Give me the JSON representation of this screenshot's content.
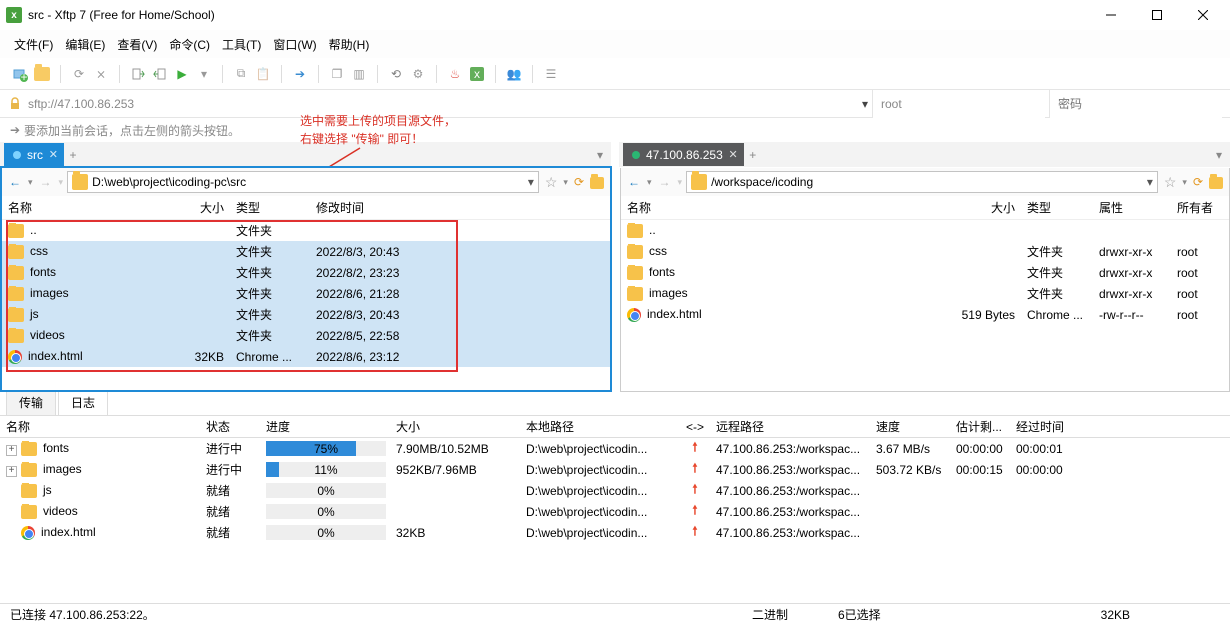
{
  "window": {
    "title": "src - Xftp 7 (Free for Home/School)"
  },
  "menu": {
    "file": "文件(F)",
    "edit": "编辑(E)",
    "view": "查看(V)",
    "cmd": "命令(C)",
    "tool": "工具(T)",
    "win": "窗口(W)",
    "help": "帮助(H)"
  },
  "conn": {
    "host": "sftp://47.100.86.253",
    "user": "root",
    "pass_placeholder": "密码"
  },
  "hint": "要添加当前会话，点击左侧的箭头按钮。",
  "callout_l1": "选中需要上传的项目源文件，",
  "callout_l2": "右键选择 \"传输\" 即可！",
  "left": {
    "tab": "src",
    "path": "D:\\web\\project\\icoding-pc\\src",
    "cols": {
      "name": "名称",
      "size": "大小",
      "type": "类型",
      "time": "修改时间"
    },
    "rows": [
      {
        "icon": "folder",
        "name": "..",
        "size": "",
        "type": "文件夹",
        "time": "",
        "sel": false
      },
      {
        "icon": "folder",
        "name": "css",
        "size": "",
        "type": "文件夹",
        "time": "2022/8/3, 20:43",
        "sel": true
      },
      {
        "icon": "folder",
        "name": "fonts",
        "size": "",
        "type": "文件夹",
        "time": "2022/8/2, 23:23",
        "sel": true
      },
      {
        "icon": "folder",
        "name": "images",
        "size": "",
        "type": "文件夹",
        "time": "2022/8/6, 21:28",
        "sel": true
      },
      {
        "icon": "folder",
        "name": "js",
        "size": "",
        "type": "文件夹",
        "time": "2022/8/3, 20:43",
        "sel": true
      },
      {
        "icon": "folder",
        "name": "videos",
        "size": "",
        "type": "文件夹",
        "time": "2022/8/5, 22:58",
        "sel": true
      },
      {
        "icon": "chrome",
        "name": "index.html",
        "size": "32KB",
        "type": "Chrome ...",
        "time": "2022/8/6, 23:12",
        "sel": true
      }
    ]
  },
  "right": {
    "tab": "47.100.86.253",
    "path": "/workspace/icoding",
    "cols": {
      "name": "名称",
      "size": "大小",
      "type": "类型",
      "attr": "属性",
      "owner": "所有者"
    },
    "rows": [
      {
        "icon": "folder",
        "name": "..",
        "size": "",
        "type": "",
        "attr": "",
        "owner": ""
      },
      {
        "icon": "folder",
        "name": "css",
        "size": "",
        "type": "文件夹",
        "attr": "drwxr-xr-x",
        "owner": "root"
      },
      {
        "icon": "folder",
        "name": "fonts",
        "size": "",
        "type": "文件夹",
        "attr": "drwxr-xr-x",
        "owner": "root"
      },
      {
        "icon": "folder",
        "name": "images",
        "size": "",
        "type": "文件夹",
        "attr": "drwxr-xr-x",
        "owner": "root"
      },
      {
        "icon": "chrome",
        "name": "index.html",
        "size": "519 Bytes",
        "type": "Chrome ...",
        "attr": "-rw-r--r--",
        "owner": "root"
      }
    ]
  },
  "btabs": {
    "transfer": "传输",
    "log": "日志"
  },
  "xf_cols": {
    "name": "名称",
    "status": "状态",
    "progress": "进度",
    "size": "大小",
    "local": "本地路径",
    "dir": "<->",
    "remote": "远程路径",
    "speed": "速度",
    "left": "估计剩...",
    "elapsed": "经过时间"
  },
  "transfers": [
    {
      "exp": true,
      "icon": "folder",
      "name": "fonts",
      "status": "进行中",
      "pct": 75,
      "size": "7.90MB/10.52MB",
      "local": "D:\\web\\project\\icodin...",
      "remote": "47.100.86.253:/workspac...",
      "speed": "3.67 MB/s",
      "left": "00:00:00",
      "elapsed": "00:00:01"
    },
    {
      "exp": true,
      "icon": "folder",
      "name": "images",
      "status": "进行中",
      "pct": 11,
      "size": "952KB/7.96MB",
      "local": "D:\\web\\project\\icodin...",
      "remote": "47.100.86.253:/workspac...",
      "speed": "503.72 KB/s",
      "left": "00:00:15",
      "elapsed": "00:00:00"
    },
    {
      "exp": false,
      "icon": "folder",
      "name": "js",
      "status": "就绪",
      "pct": 0,
      "size": "",
      "local": "D:\\web\\project\\icodin...",
      "remote": "47.100.86.253:/workspac...",
      "speed": "",
      "left": "",
      "elapsed": ""
    },
    {
      "exp": false,
      "icon": "folder",
      "name": "videos",
      "status": "就绪",
      "pct": 0,
      "size": "",
      "local": "D:\\web\\project\\icodin...",
      "remote": "47.100.86.253:/workspac...",
      "speed": "",
      "left": "",
      "elapsed": ""
    },
    {
      "exp": false,
      "icon": "chrome",
      "name": "index.html",
      "status": "就绪",
      "pct": 0,
      "size": "32KB",
      "local": "D:\\web\\project\\icodin...",
      "remote": "47.100.86.253:/workspac...",
      "speed": "",
      "left": "",
      "elapsed": ""
    }
  ],
  "status": {
    "conn": "已连接 47.100.86.253:22。",
    "mode": "二进制",
    "sel": "6已选择",
    "size": "32KB"
  }
}
